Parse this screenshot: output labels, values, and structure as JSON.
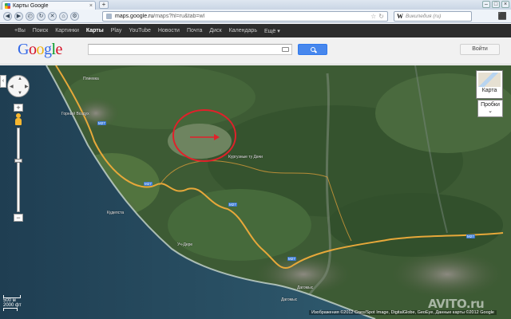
{
  "browser": {
    "tab_title": "Карты Google",
    "tab_close": "×",
    "new_tab": "+",
    "url_host": "maps.google.ru",
    "url_prefix": "",
    "url_path": "/maps?hl=ru&tab=wl",
    "search_engine_icon": "W",
    "search_placeholder": "Википедия (ru)",
    "window_buttons": [
      "–",
      "□",
      "×"
    ]
  },
  "gbar": {
    "items": [
      "+Вы",
      "Поиск",
      "Картинки",
      "Карты",
      "Play",
      "YouTube",
      "Новости",
      "Почта",
      "Диск",
      "Календарь",
      "Ещё ▾"
    ],
    "active_index": 3
  },
  "header": {
    "logo_letters": [
      "G",
      "o",
      "o",
      "g",
      "l",
      "e"
    ],
    "search_value": "",
    "signin_label": "Войти"
  },
  "map": {
    "maptype_label": "Карта",
    "traffic_label": "Пробки",
    "traffic_chevron": "⌄",
    "zoom_in": "+",
    "zoom_out": "−",
    "zoom_level_fraction": 0.62,
    "scale_metric": "500 м",
    "scale_imperial": "2000 фт",
    "attribution": "Изображения ©2012 Cnes/Spot Image, DigitalGlobe, GeoEye, Данные карты ©2012 Google",
    "watermark": "AVITO.ru",
    "google_watermark": "Google",
    "road_badge": "M27",
    "place_labels": [
      "Горный Воздух",
      "Кудепста",
      "Кургузные ту Дачи",
      "Хоста",
      "Дагомыс",
      "Дагомыс",
      "Уч-Дере",
      "Плиевка"
    ],
    "colors": {
      "sea": "#25465a",
      "forest": "#3c5a34",
      "road": "#e7a83a",
      "annotation_circle": "#e2202a"
    }
  }
}
